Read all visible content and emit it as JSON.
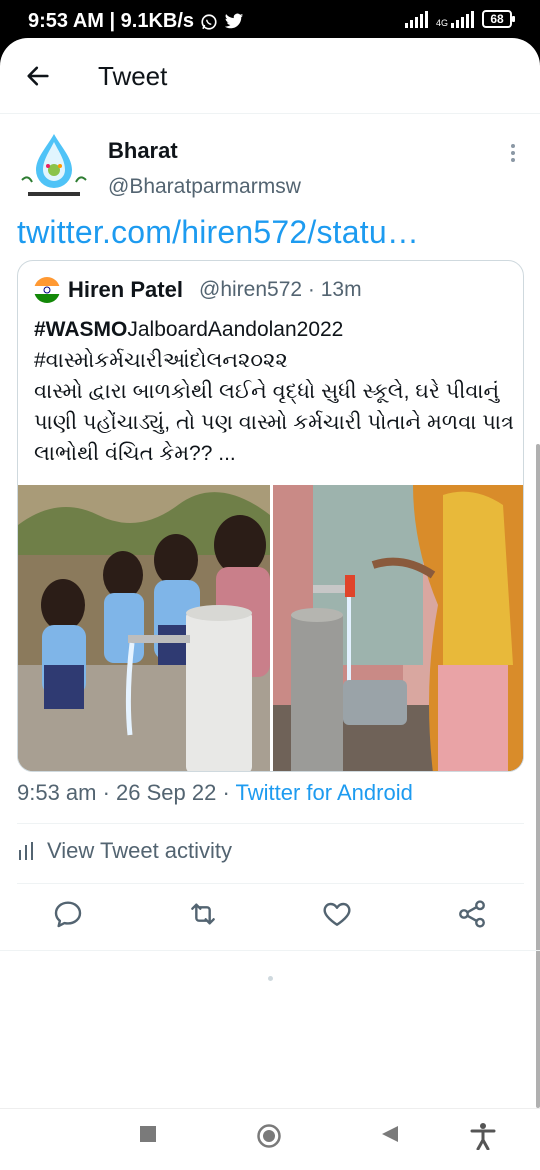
{
  "status_bar": {
    "time_speed": "9:53 AM | 9.1KB/s",
    "network": "4G",
    "battery": "68",
    "icons": [
      "whatsapp-icon",
      "twitter-icon",
      "signal-icon",
      "battery-icon"
    ]
  },
  "header": {
    "title": "Tweet",
    "back_icon": "arrow-left-icon"
  },
  "tweet": {
    "author_name": "Bharat",
    "author_handle": "@Bharatparmarmsw",
    "link_text": "twitter.com/hiren572/statu…",
    "timestamp": "9:53 am · 26 Sep 22 · ",
    "source": "Twitter for Android",
    "view_activity": "View Tweet activity"
  },
  "quoted_tweet": {
    "author_name": "Hiren Patel",
    "author_handle": "@hiren572 · 13m",
    "hashtag_bold": "#WASMO",
    "hashtag_rest": "JalboardAandolan2022",
    "body": "#વાસ્મોકર્મચારીઆંદોલન૨૦૨૨\nવાસ્મો દ્વારા બાળકોથી લઈને વૃદ્ધો સુધી સ્કૂલે, ઘરે પીવાનું પાણી પહોંચાડ્યું, તો પણ વાસ્મો કર્મચારી પોતાને મળવા પાત્ર લાભોથી વંચિત કેમ?? ..."
  },
  "actions": {
    "items": [
      "reply-icon",
      "retweet-icon",
      "like-icon",
      "share-icon"
    ]
  },
  "colors": {
    "accent": "#1d9bf0",
    "text_primary": "#0f1419",
    "text_secondary": "#536471",
    "border": "#cfd9de"
  }
}
